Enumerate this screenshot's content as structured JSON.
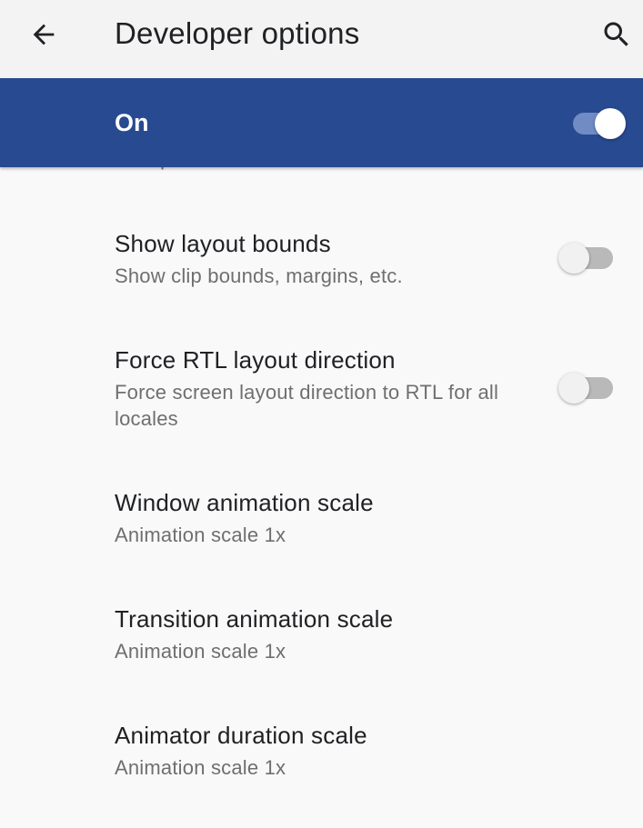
{
  "appbar": {
    "title": "Developer options",
    "back_icon": "arrow-left-icon",
    "search_icon": "search-icon"
  },
  "master": {
    "label": "On",
    "checked": true
  },
  "clipped_summary": "are updated",
  "prefs": [
    {
      "title": "Show layout bounds",
      "summary": "Show clip bounds, margins, etc.",
      "switch": false
    },
    {
      "title": "Force RTL layout direction",
      "summary": "Force screen layout direction to RTL for all locales",
      "switch": false
    },
    {
      "title": "Window animation scale",
      "summary": "Animation scale 1x"
    },
    {
      "title": "Transition animation scale",
      "summary": "Animation scale 1x"
    },
    {
      "title": "Animator duration scale",
      "summary": "Animation scale 1x"
    }
  ],
  "colors": {
    "master_bar": "#284a91",
    "appbar": "#f3f3f3",
    "background": "#f9f9f9"
  }
}
